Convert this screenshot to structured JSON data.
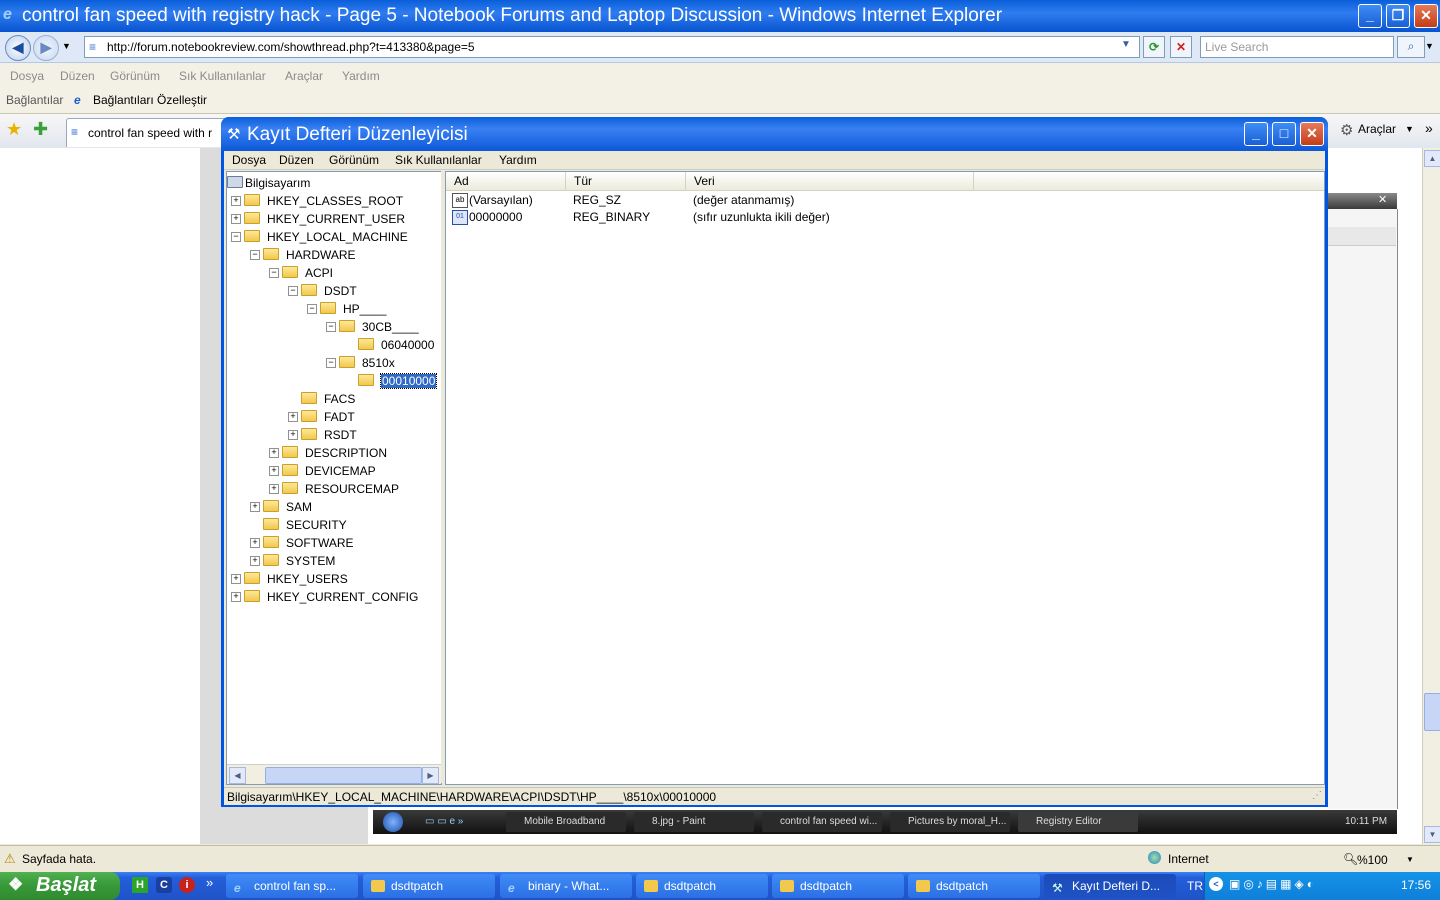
{
  "ie": {
    "title": "control fan speed with registry hack - Page 5 - Notebook Forums and Laptop Discussion - Windows Internet Explorer",
    "address": "http://forum.notebookreview.com/showthread.php?t=413380&page=5",
    "search_placeholder": "Live Search",
    "menu": [
      "Dosya",
      "Düzen",
      "Görünüm",
      "Sık Kullanılanlar",
      "Araçlar",
      "Yardım"
    ],
    "links_label": "Bağlantılar",
    "links_item": "Bağlantıları Özelleştir",
    "tab_title": "control fan speed with r",
    "tools_label": "Araçlar",
    "status_text": "Sayfada hata.",
    "zone": "Internet",
    "zoom": "%100"
  },
  "regedit": {
    "title": "Kayıt Defteri Düzenleyicisi",
    "menu": [
      "Dosya",
      "Düzen",
      "Görünüm",
      "Sık Kullanılanlar",
      "Yardım"
    ],
    "tree": [
      {
        "label": "Bilgisayarım",
        "depth": 0,
        "exp": "",
        "root": true
      },
      {
        "label": "HKEY_CLASSES_ROOT",
        "depth": 0,
        "exp": "+"
      },
      {
        "label": "HKEY_CURRENT_USER",
        "depth": 0,
        "exp": "+"
      },
      {
        "label": "HKEY_LOCAL_MACHINE",
        "depth": 0,
        "exp": "-"
      },
      {
        "label": "HARDWARE",
        "depth": 1,
        "exp": "-"
      },
      {
        "label": "ACPI",
        "depth": 2,
        "exp": "-"
      },
      {
        "label": "DSDT",
        "depth": 3,
        "exp": "-"
      },
      {
        "label": "HP____",
        "depth": 4,
        "exp": "-"
      },
      {
        "label": "30CB____",
        "depth": 5,
        "exp": "-"
      },
      {
        "label": "06040000",
        "depth": 6,
        "exp": ""
      },
      {
        "label": "8510x",
        "depth": 5,
        "exp": "-"
      },
      {
        "label": "00010000",
        "depth": 6,
        "exp": "",
        "selected": true
      },
      {
        "label": "FACS",
        "depth": 3,
        "exp": ""
      },
      {
        "label": "FADT",
        "depth": 3,
        "exp": "+"
      },
      {
        "label": "RSDT",
        "depth": 3,
        "exp": "+"
      },
      {
        "label": "DESCRIPTION",
        "depth": 2,
        "exp": "+"
      },
      {
        "label": "DEVICEMAP",
        "depth": 2,
        "exp": "+"
      },
      {
        "label": "RESOURCEMAP",
        "depth": 2,
        "exp": "+"
      },
      {
        "label": "SAM",
        "depth": 1,
        "exp": "+"
      },
      {
        "label": "SECURITY",
        "depth": 1,
        "exp": ""
      },
      {
        "label": "SOFTWARE",
        "depth": 1,
        "exp": "+"
      },
      {
        "label": "SYSTEM",
        "depth": 1,
        "exp": "+"
      },
      {
        "label": "HKEY_USERS",
        "depth": 0,
        "exp": "+"
      },
      {
        "label": "HKEY_CURRENT_CONFIG",
        "depth": 0,
        "exp": "+"
      }
    ],
    "columns": [
      "Ad",
      "Tür",
      "Veri"
    ],
    "values": [
      {
        "name": "(Varsayılan)",
        "type": "REG_SZ",
        "data": "(değer atanmamış)",
        "icon": "string-value-icon"
      },
      {
        "name": "00000000",
        "type": "REG_BINARY",
        "data": "(sıfır uzunlukta ikili değer)",
        "icon": "binary-value-icon"
      }
    ],
    "status_path": "Bilgisayarım\\HKEY_LOCAL_MACHINE\\HARDWARE\\ACPI\\DSDT\\HP____\\8510x\\00010000"
  },
  "inner_taskbar": {
    "items": [
      "Mobile Broadband",
      "8.jpg - Paint",
      "control fan speed wi...",
      "Pictures by moral_H...",
      "Registry Editor"
    ],
    "clock": "10:11 PM"
  },
  "taskbar": {
    "start_label": "Başlat",
    "items": [
      "control fan sp...",
      "dsdtpatch",
      "binary - What...",
      "dsdtpatch",
      "dsdtpatch",
      "dsdtpatch",
      "Kayıt Defteri D..."
    ],
    "lang": "TR",
    "clock": "17:56"
  },
  "colors": {
    "xp_blue": "#0054e3",
    "selection": "#316ac5",
    "start_green": "#3a9c3a"
  }
}
